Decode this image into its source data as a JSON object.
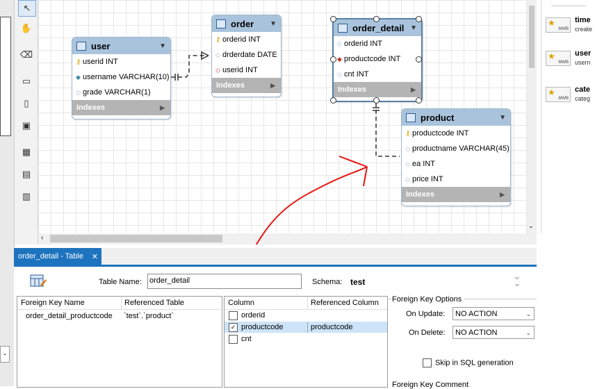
{
  "entities": {
    "user": {
      "name": "user",
      "columns": [
        "userid INT",
        "username VARCHAR(10)",
        "grade VARCHAR(1)"
      ],
      "indexes_label": "Indexes"
    },
    "order": {
      "name": "order",
      "columns": [
        "orderid INT",
        "drderdate DATE",
        "userid INT"
      ],
      "indexes_label": "Indexes"
    },
    "order_detail": {
      "name": "order_detail",
      "columns": [
        "orderid INT",
        "productcode INT",
        "cnt INT"
      ],
      "indexes_label": "Indexes"
    },
    "product": {
      "name": "product",
      "columns": [
        "productcode INT",
        "productname VARCHAR(45)",
        "ea INT",
        "price INT"
      ],
      "indexes_label": "Indexes"
    }
  },
  "snippets": [
    {
      "title": "time",
      "sub": "create",
      "badge": "MWB"
    },
    {
      "title": "user",
      "sub": "usern",
      "badge": "MWB"
    },
    {
      "title": "cate",
      "sub": "categ",
      "badge": "MWB"
    }
  ],
  "editor": {
    "tab_label": "order_detail - Table",
    "table_name_label": "Table Name:",
    "table_name_value": "order_detail",
    "schema_label": "Schema:",
    "schema_value": "test",
    "fk_headers": [
      "Foreign Key Name",
      "Referenced Table"
    ],
    "fk_rows": [
      {
        "name": "order_detail_productcode",
        "ref": "`test`.`product`"
      }
    ],
    "col_headers": [
      "Column",
      "Referenced Column"
    ],
    "col_rows": [
      {
        "column": "orderid",
        "checked": false,
        "ref": ""
      },
      {
        "column": "productcode",
        "checked": true,
        "ref": "productcode"
      },
      {
        "column": "cnt",
        "checked": false,
        "ref": ""
      }
    ],
    "fk_options_title": "Foreign Key Options",
    "on_update_label": "On Update:",
    "on_update_value": "NO ACTION",
    "on_delete_label": "On Delete:",
    "on_delete_value": "NO ACTION",
    "skip_label": "Skip in SQL generation",
    "fk_comment_label": "Foreign Key Comment"
  },
  "colors": {
    "accent": "#1e73be",
    "entity_header": "#a9c3dc",
    "annotation": "#e8140f"
  }
}
